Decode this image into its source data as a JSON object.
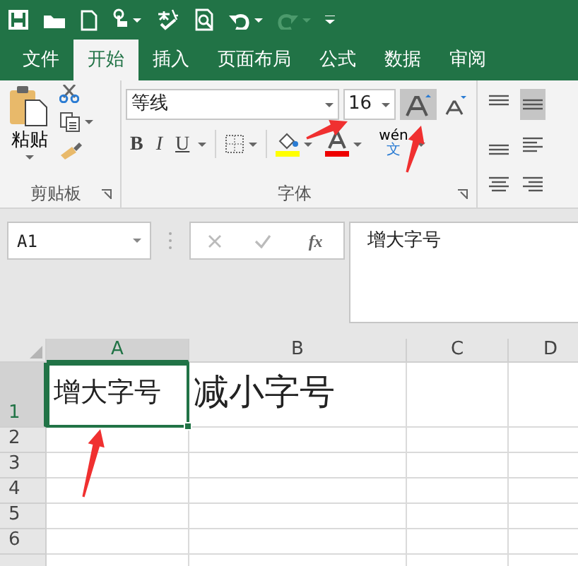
{
  "tabs": [
    {
      "label": "文件",
      "selected": false
    },
    {
      "label": "开始",
      "selected": true
    },
    {
      "label": "插入",
      "selected": false
    },
    {
      "label": "页面布局",
      "selected": false
    },
    {
      "label": "公式",
      "selected": false
    },
    {
      "label": "数据",
      "selected": false
    },
    {
      "label": "审阅",
      "selected": false
    }
  ],
  "clipboard": {
    "paste_label": "粘贴",
    "group_label": "剪贴板"
  },
  "font": {
    "font_name": "等线",
    "font_size": "16",
    "grow_font_active": true,
    "style_buttons": [
      "B",
      "I",
      "U"
    ],
    "phonetic_top": "wén",
    "phonetic_bottom": "文",
    "group_label": "字体"
  },
  "alignment": [
    {
      "kind": "top",
      "selected": false
    },
    {
      "kind": "middle",
      "selected": true
    },
    {
      "kind": "bottom",
      "selected": false
    },
    {
      "kind": "left",
      "selected": false
    },
    {
      "kind": "center",
      "selected": false
    },
    {
      "kind": "right",
      "selected": false
    }
  ],
  "name_box": "A1",
  "formula_bar": {
    "function_label": "fx",
    "content": "增大字号"
  },
  "columns": [
    {
      "label": "A",
      "selected": true
    },
    {
      "label": "B",
      "selected": false
    },
    {
      "label": "C",
      "selected": false
    },
    {
      "label": "D",
      "selected": false
    }
  ],
  "rows": [
    {
      "label": "1",
      "selected": true,
      "cells": [
        {
          "text": "增大字号",
          "selected": true
        },
        {
          "text": "减小字号",
          "selected": false
        }
      ]
    },
    {
      "label": "2",
      "selected": false
    },
    {
      "label": "3",
      "selected": false
    },
    {
      "label": "4",
      "selected": false
    },
    {
      "label": "5",
      "selected": false
    },
    {
      "label": "6",
      "selected": false
    }
  ]
}
